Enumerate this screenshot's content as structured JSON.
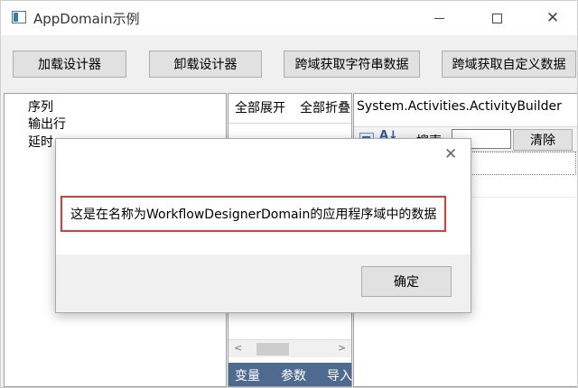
{
  "window": {
    "title": "AppDomain示例",
    "icon": "app-window-icon",
    "controls": {
      "minimize": "minimize-icon",
      "maximize": "maximize-icon",
      "close": "close-icon"
    }
  },
  "toolbar": {
    "load_label": "加载设计器",
    "unload_label": "卸载设计器",
    "get_string_label": "跨域获取字符串数据",
    "get_custom_label": "跨域获取自定义数据"
  },
  "toolbox": {
    "items": [
      "序列",
      "输出行",
      "延时"
    ]
  },
  "designer": {
    "expand_all": "全部展开",
    "collapse_all": "全部折叠",
    "tabs": [
      "变量",
      "参数",
      "导入"
    ]
  },
  "properties": {
    "title": "System.Activities.ActivityBuilder",
    "search_label": "搜索:",
    "search_value": "",
    "clear_label": "清除"
  },
  "dialog": {
    "message": "这是在名称为WorkflowDesignerDomain的应用程序域中的数据",
    "ok_label": "确定",
    "highlight_color": "#e03a3a"
  },
  "colors": {
    "tab_bar": "#4e6a8e",
    "button_face": "#e1e1e1"
  }
}
